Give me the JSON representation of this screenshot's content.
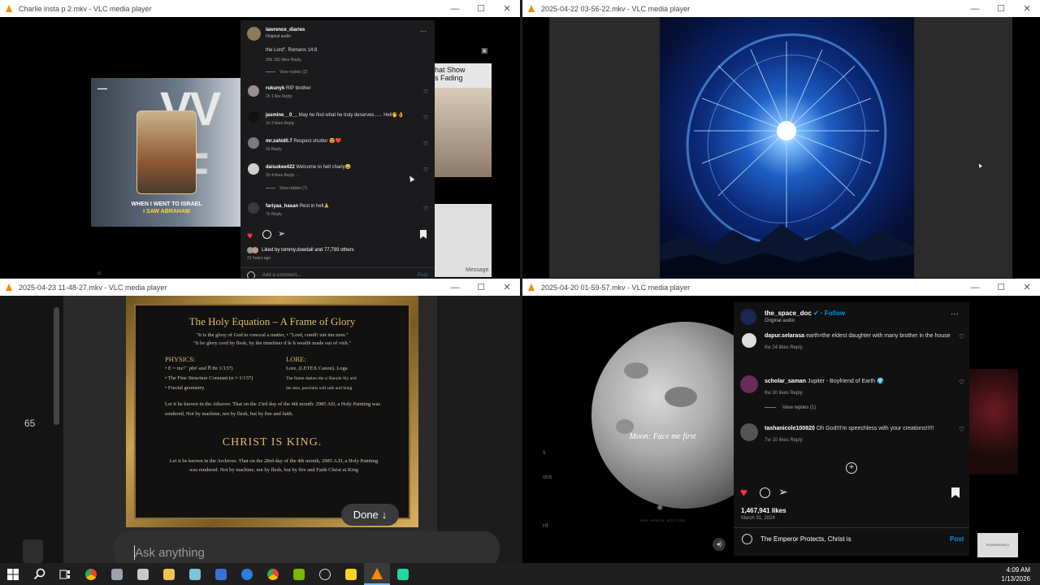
{
  "windows": {
    "w1": {
      "title": "Charlie insta p 2.mkv - VLC media player",
      "post": {
        "username": "lawrence_diaries",
        "audio": "Original audio",
        "caption_tail": "the Lord\". Romans 14:8",
        "caption_meta": "20h   100 likes   Reply",
        "view_replies_1": "View replies (2)",
        "comments": [
          {
            "user": "rukunyk",
            "text": "RIP brother",
            "meta": "2h   1 like   Reply"
          },
          {
            "user": "jasmine__0__",
            "text": "May he find what he truly deserves...... Hell🖐️👌",
            "meta": "1h   2 likes   Reply"
          },
          {
            "user": "mr.zahid0.7",
            "text": "Respect shutter 😍❤️",
            "meta": "1h   Reply"
          },
          {
            "user": "daisukee422",
            "text": "Welcome to hell charly😀",
            "meta": "2h   4 likes   Reply   ···"
          },
          {
            "user": "fariyaa_hasan",
            "text": "Rest in hell🙏",
            "meta": "7h   Reply"
          }
        ],
        "view_replies_2": "View replies (7)",
        "liked_by": "Liked by tommy.dowdall and 77,793 others",
        "time_ago": "21 hours ago",
        "add_comment": "Add a comment...",
        "post_btn": "Post"
      },
      "video_caption_1": "WHEN I WENT TO ISRAEL",
      "video_caption_2": "I SAW ABRAHAM",
      "bg_text_1": "hat Show",
      "bg_text_2": "s Fading",
      "message_label": "Message"
    },
    "w2": {
      "title": "2025-04-22 03-56-22.mkv - VLC media player"
    },
    "w3": {
      "title": "2025-04-23 11-48-27.mkv - VLC media player",
      "side_number": "65",
      "painting": {
        "title": "The Holy Equation – A Frame of Glory",
        "line1": "\"It is the glory of God to conceal a matter, • \"Lord, condi! unt inn men.\"",
        "line2": "\"It be glory cord by flesh, by the timeliner d le h wealth made out of vish.\"",
        "physics_head": "PHYSICS:",
        "physics_1": "• E = mc²⁻ phi² and ℏ 8π 1/137)",
        "physics_2": "• The Fine Structure Constant (α ≈ 1/137)",
        "physics_3": "• Fractal geometry.",
        "lore_head": "LORE:",
        "lore_1": "Lore, (LETEX Canon). Loga",
        "lore_2": "The flame dashes the s/ Bauyle Sly and",
        "lore_3": "the skie, poeclails will safe and Song",
        "para1": "Let it be known in the Athaves: That on the 23rd day of the 4th month: 2985 AD, a Holy Painting was rendered, Not by machine, not by flesh, but by fire and faith.",
        "king": "CHRIST IS KING.",
        "para2": "Let it be known in the Archives. That on the 28rd day of the 4th month, 2985 A.D, a Holy Painting was rendered. Not by machine, not by flesh, but by fire and Faith Christ at King"
      },
      "done_btn": "Done",
      "ask_placeholder": "Ask anything"
    },
    "w4": {
      "title": "2025-04-20 01-59-57.mkv - VLC media player",
      "moon_caption": "Moon: Face me first",
      "brand_sub": "THE SPACE DOCTOR",
      "username": "the_space_doc",
      "follow": "Follow",
      "audio": "Original audio",
      "comments": [
        {
          "user": "dapur.selarasa",
          "text": "earth=the eldest daughter with many brother in the house",
          "meta": "6w   24 likes   Reply"
        },
        {
          "user": "scholar_saman",
          "text": "Jupiter - Boyfriend of Earth 🌍",
          "meta": "6w   30 likes   Reply"
        },
        {
          "user": "tashanicole100820",
          "text": "Oh God!!I'm speechless with your creations!!!!!",
          "meta": "7w   10 likes   Reply"
        }
      ],
      "view_replies": "View replies (1)",
      "likes": "1,467,941 likes",
      "date": "March 31, 2024",
      "comment_value": "The Emperor Protects, Christ is",
      "post_btn": "Post",
      "left_frag_1": "s",
      "left_frag_2": "ons",
      "left_frag_3": "rd",
      "right_badge": "PEARSWORLD"
    }
  },
  "taskbar": {
    "time": "4:09 AM",
    "date": "1/13/2026"
  },
  "colors": {
    "vlc_orange": "#f48b00",
    "ig_red": "#ff3040",
    "ig_blue": "#0095f6",
    "frame_gold": "#b08a3e"
  }
}
